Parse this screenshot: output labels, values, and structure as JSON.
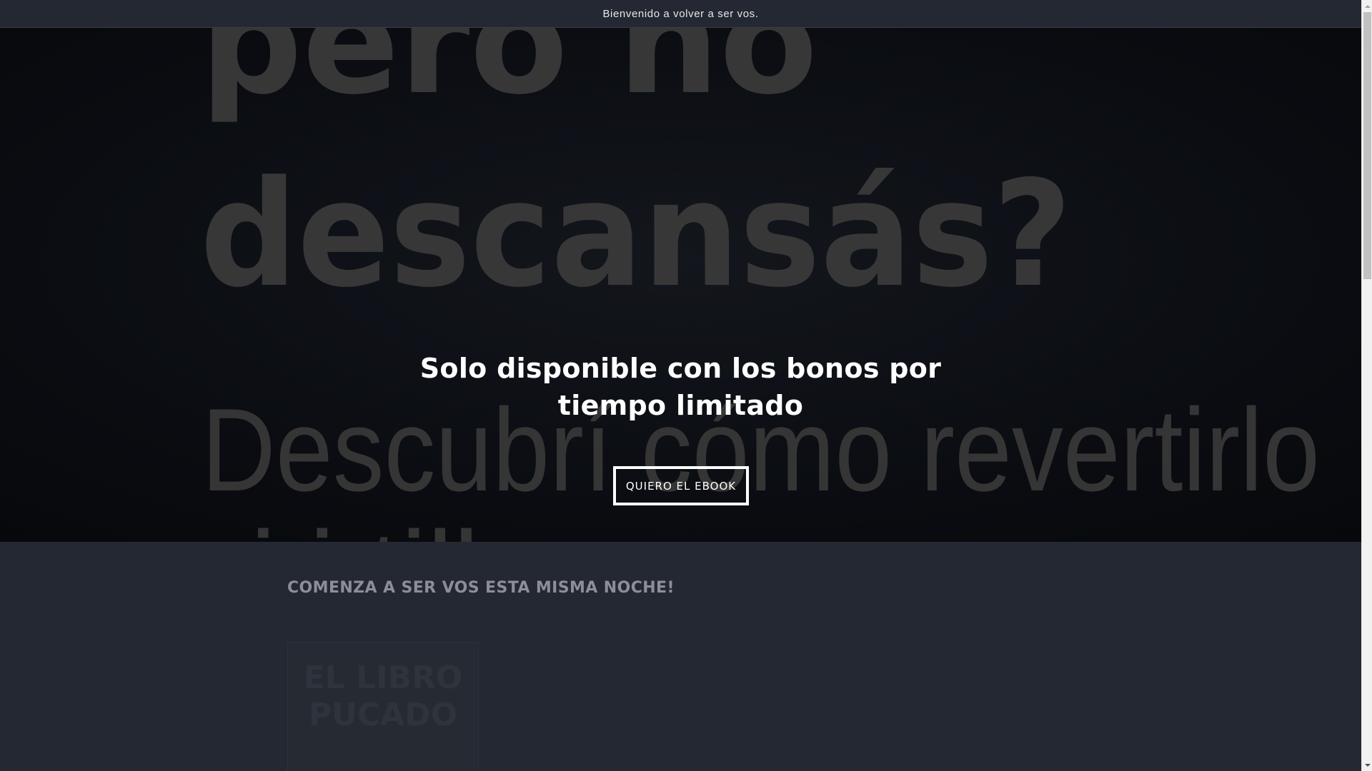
{
  "announcement": {
    "text": "Bienvenido a volver a ser vos."
  },
  "hero": {
    "background_lines": [
      "pero no",
      "descansás?",
      "Descubrí cómo revertirlo",
      "i i till"
    ],
    "heading": "Solo disponible con los bonos por tiempo limitado",
    "button_label": "QUIERO EL EBOOK"
  },
  "section": {
    "title": "COMENZA A SER VOS ESTA MISMA NOCHE!",
    "product": {
      "image_lines": [
        "EL LIBRO",
        "PUCADO"
      ]
    }
  },
  "colors": {
    "page_background": "#242833",
    "hero_background": "#0c0f14",
    "text_primary": "#ffffff",
    "section_title": "#8d8f96"
  }
}
